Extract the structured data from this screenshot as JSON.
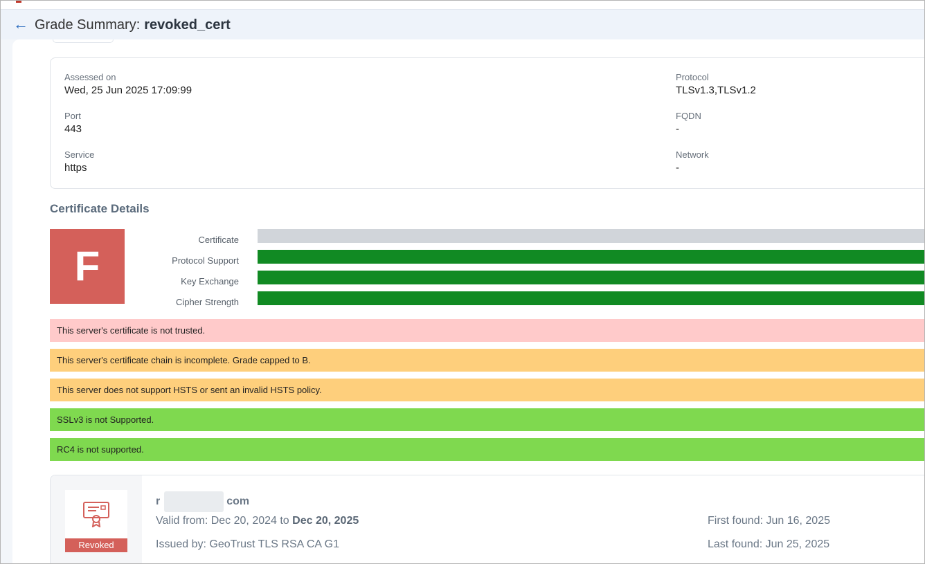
{
  "header": {
    "title_prefix": "Grade Summary:",
    "title_name": "revoked_cert"
  },
  "info": {
    "assessed_on_label": "Assessed on",
    "assessed_on_value": "Wed, 25 Jun 2025 17:09:99",
    "port_label": "Port",
    "port_value": "443",
    "service_label": "Service",
    "service_value": "https",
    "protocol_label": "Protocol",
    "protocol_value": "TLSv1.3,TLSv1.2",
    "fqdn_label": "FQDN",
    "fqdn_value": "-",
    "network_label": "Network",
    "network_value": "-"
  },
  "certificate_details": {
    "section_title": "Certificate Details",
    "grade": "F",
    "metrics": [
      {
        "label": "Certificate",
        "score_fraction": 1.0,
        "color": "#d1d5da"
      },
      {
        "label": "Protocol Support",
        "score_fraction": 1.0,
        "color": "#118a23"
      },
      {
        "label": "Key Exchange",
        "score_fraction": 1.0,
        "color": "#118a23"
      },
      {
        "label": "Cipher Strength",
        "score_fraction": 1.0,
        "color": "#118a23"
      }
    ]
  },
  "alerts": [
    {
      "text": "This server's certificate is not trusted.",
      "color": "#ffcaca"
    },
    {
      "text": "This server's certificate chain is incomplete. Grade capped to B.",
      "color": "#fecf7c"
    },
    {
      "text": "This server does not support HSTS or sent an invalid HSTS policy.",
      "color": "#fecf7c"
    },
    {
      "text": "SSLv3 is not Supported.",
      "color": "#7fd94f"
    },
    {
      "text": "RC4 is not supported.",
      "color": "#7fd94f"
    }
  ],
  "cert": {
    "host_start": "r",
    "host_end": "com",
    "status_badge": "Revoked",
    "valid_from_prefix": "Valid from: Dec 20, 2024 to",
    "valid_to": "Dec 20, 2025",
    "issued_by": "Issued by: GeoTrust TLS RSA CA G1",
    "first_found": "First found: Jun 16, 2025",
    "last_found": "Last found: Jun 25, 2025"
  }
}
